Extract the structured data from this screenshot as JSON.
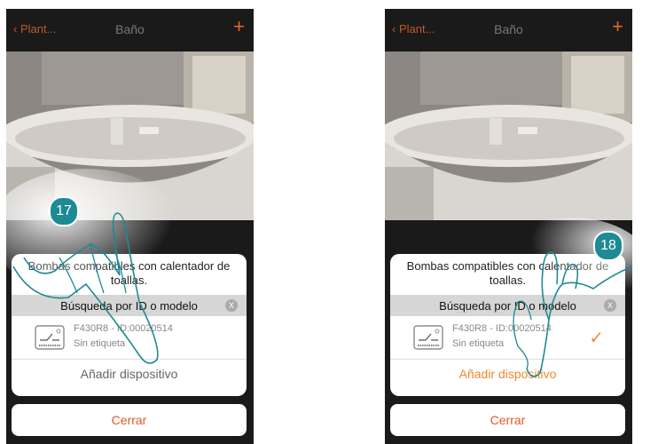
{
  "screens": [
    {
      "header": {
        "back_label": "‹ Plant...",
        "title": "Baño",
        "add_icon": "+"
      },
      "dialog": {
        "title": "Bombas compatibles con calentador de toallas.",
        "search_label": "Búsqueda por ID o modelo",
        "clear_label": "X",
        "device_name": "F430R8 - ID:00020514",
        "device_label": "Sin etiqueta",
        "add_label": "Añadir dispositivo",
        "selected": false
      },
      "close_label": "Cerrar",
      "step": "17"
    },
    {
      "header": {
        "back_label": "‹ Plant...",
        "title": "Baño",
        "add_icon": "+"
      },
      "dialog": {
        "title": "Bombas compatibles con calentador de toallas.",
        "search_label": "Búsqueda por ID o modelo",
        "clear_label": "X",
        "device_name": "F430R8 - ID:00020514",
        "device_label": "Sin etiqueta",
        "add_label": "Añadir dispositivo",
        "selected": true,
        "check_icon": "✓"
      },
      "close_label": "Cerrar",
      "step": "18"
    }
  ],
  "colors": {
    "accent": "#e06a24",
    "step_badge": "#1e8a93",
    "dark_bg": "#1a1a1a"
  }
}
